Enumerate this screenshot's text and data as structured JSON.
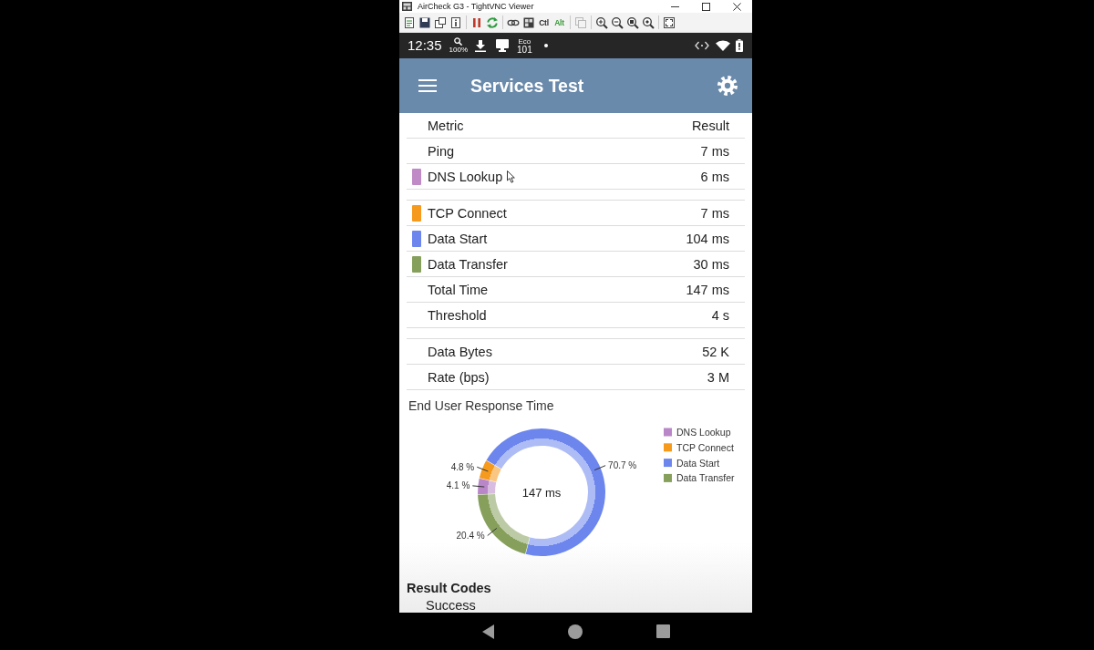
{
  "window": {
    "title": "AirCheck G3 - TightVNC Viewer"
  },
  "toolbar": {
    "key_buttons": [
      {
        "label": "Ctl",
        "color": "#2b2b2b"
      },
      {
        "label": "Alt",
        "color": "#3c9a3c"
      }
    ]
  },
  "status_bar": {
    "time": "12:35",
    "zoom_label": "100%",
    "eco_label": "Eco",
    "eco_number": "101"
  },
  "app_bar": {
    "title": "Services Test"
  },
  "table": {
    "columns": [
      "Metric",
      "Result"
    ],
    "sections": [
      {
        "rows": [
          {
            "metric": "Ping",
            "result": "7 ms"
          },
          {
            "metric": "DNS Lookup",
            "result": "6 ms",
            "color": "#c08ac6"
          }
        ]
      },
      {
        "rows": [
          {
            "metric": "TCP Connect",
            "result": "7 ms",
            "color": "#f59a1c"
          },
          {
            "metric": "Data Start",
            "result": "104 ms",
            "color": "#6c86ee"
          },
          {
            "metric": "Data Transfer",
            "result": "30 ms",
            "color": "#86a05c"
          },
          {
            "metric": "Total Time",
            "result": "147 ms"
          },
          {
            "metric": "Threshold",
            "result": "4 s"
          }
        ]
      },
      {
        "rows": [
          {
            "metric": "Data Bytes",
            "result": "52 K"
          },
          {
            "metric": "Rate (bps)",
            "result": "3 M"
          }
        ]
      }
    ]
  },
  "response_chart": {
    "center_label": "147 ms",
    "legend": [
      {
        "label": "DNS Lookup",
        "color": "#b987c8"
      },
      {
        "label": "TCP Connect",
        "color": "#f59a1c"
      },
      {
        "label": "Data Start",
        "color": "#6c86ee"
      },
      {
        "label": "Data Transfer",
        "color": "#86a05c"
      }
    ],
    "chart_data": {
      "type": "donut",
      "title": "End User Response Time",
      "values": [
        4.1,
        4.8,
        70.7,
        20.4
      ],
      "value_labels": [
        "4.1 %",
        "4.8 %",
        "70.7 %",
        "20.4 %"
      ]
    }
  },
  "result_codes": {
    "title": "Result Codes",
    "items": [
      "Success"
    ]
  }
}
